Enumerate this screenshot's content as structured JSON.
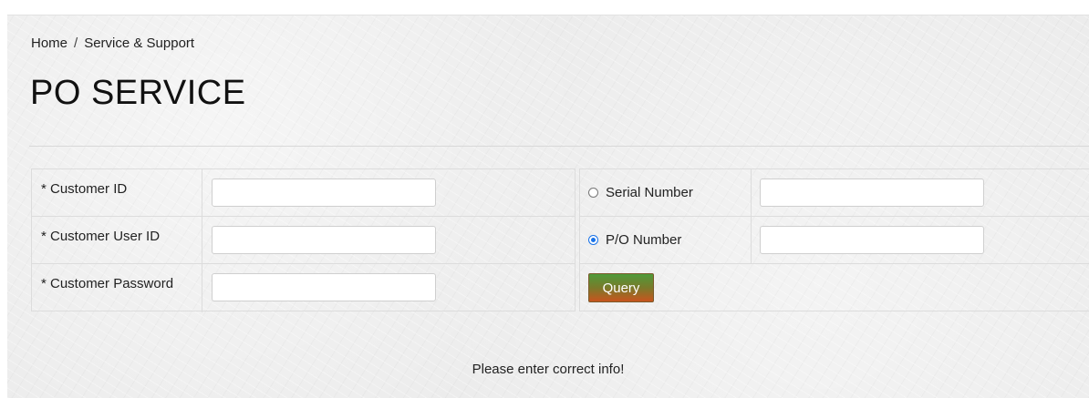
{
  "breadcrumb": {
    "home": "Home",
    "separator": "/",
    "current": "Service & Support"
  },
  "page": {
    "title": "PO SERVICE"
  },
  "form": {
    "customer_id_label": "* Customer ID",
    "customer_user_id_label": "* Customer User ID",
    "customer_password_label": "* Customer Password",
    "customer_id_value": "",
    "customer_user_id_value": "",
    "customer_password_value": "",
    "search_options": [
      {
        "label": "Serial Number",
        "checked": false,
        "value": ""
      },
      {
        "label": "P/O Number",
        "checked": true,
        "value": ""
      }
    ],
    "query_label": "Query"
  },
  "status_message": "Please enter correct info!",
  "colors": {
    "radio_checked": "#1a73e8",
    "query_gradient_top": "#4f9a3a",
    "query_gradient_bottom": "#c8541e"
  }
}
